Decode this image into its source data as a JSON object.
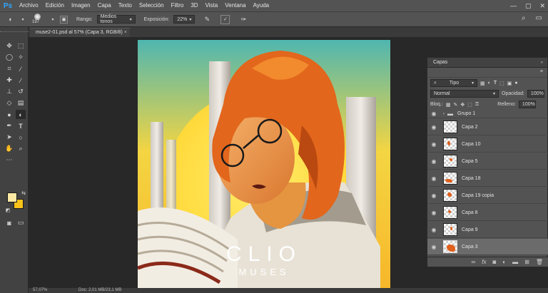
{
  "app": {
    "logo": "Ps"
  },
  "menu": [
    "Archivo",
    "Edición",
    "Imagen",
    "Capa",
    "Texto",
    "Selección",
    "Filtro",
    "3D",
    "Vista",
    "Ventana",
    "Ayuda"
  ],
  "options": {
    "brush_size": "197",
    "range_label": "Rango:",
    "range_value": "Medios tonos",
    "exposure_label": "Exposición:",
    "exposure_value": "22%"
  },
  "document_tab": {
    "title": "muse2-01.psd al 57% (Capa 3, RGB/8)",
    "close": "×"
  },
  "colors": {
    "foreground": "#fde8a3",
    "background": "#f8c21a"
  },
  "artwork": {
    "title": "CLIO",
    "subtitle": "MUSES"
  },
  "status": {
    "zoom": "57,07%",
    "doc": "Doc: 2,01 MB/23,1 MB"
  },
  "layers_panel": {
    "title": "Capas",
    "filter_kind": "Tipo",
    "blend_mode": "Normal",
    "opacity_label": "Opacidad:",
    "opacity_value": "100%",
    "lock_label": "Bloq.:",
    "fill_label": "Relleno:",
    "fill_value": "100%",
    "layers": [
      {
        "name": "Grupo 1",
        "type": "group"
      },
      {
        "name": "Capa 2"
      },
      {
        "name": "Capa 10"
      },
      {
        "name": "Capa 5"
      },
      {
        "name": "Capa 18"
      },
      {
        "name": "Capa 19 copia"
      },
      {
        "name": "Capa 8"
      },
      {
        "name": "Capa 9"
      },
      {
        "name": "Capa 3",
        "selected": true
      }
    ]
  }
}
